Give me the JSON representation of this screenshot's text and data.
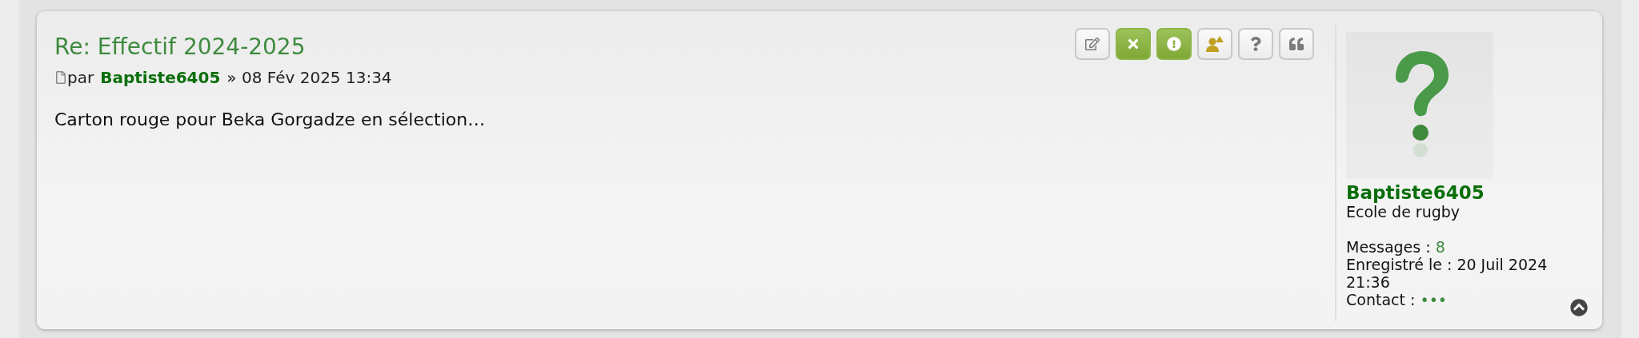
{
  "post": {
    "title": "Re: Effectif 2024-2025",
    "by": "par",
    "author": "Baptiste6405",
    "separator": "»",
    "date": "08 Fév 2025 13:34",
    "body": "Carton rouge pour Beka Gorgadze en sélection…"
  },
  "actions": [
    {
      "kind": "edit",
      "highlighted": false
    },
    {
      "kind": "delete",
      "highlighted": true
    },
    {
      "kind": "report",
      "highlighted": true
    },
    {
      "kind": "warn",
      "highlighted": false
    },
    {
      "kind": "info",
      "highlighted": false
    },
    {
      "kind": "quote",
      "highlighted": false
    }
  ],
  "profile": {
    "username": "Baptiste6405",
    "rank": "Ecole de rugby",
    "fields": [
      {
        "label": "Messages :",
        "value": "8",
        "kind": "link"
      },
      {
        "label": "Enregistré le :",
        "value": "20 Juil 2024 21:36",
        "kind": "plain"
      },
      {
        "label": "Contact :",
        "value": "•••",
        "kind": "link"
      }
    ]
  }
}
